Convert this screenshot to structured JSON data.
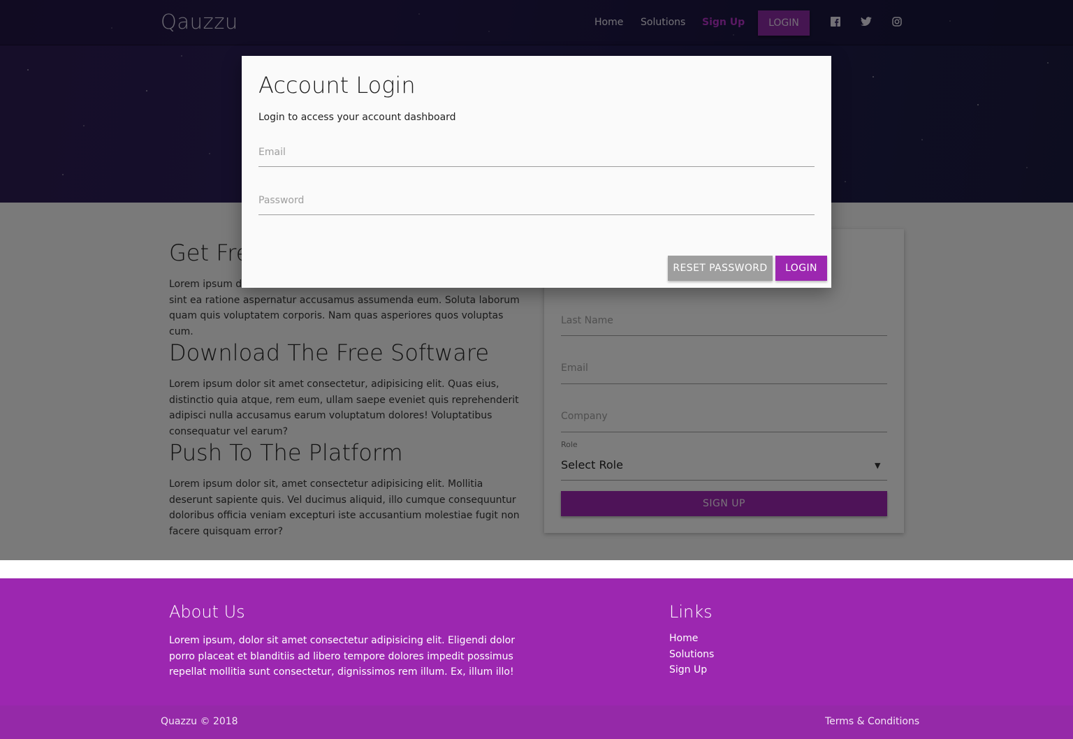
{
  "nav": {
    "brand": "Qauzzu",
    "links": [
      "Home",
      "Solutions",
      "Sign Up"
    ],
    "login": "LOGIN",
    "social_icons": [
      "facebook-icon",
      "twitter-icon",
      "instagram-icon"
    ]
  },
  "sections": [
    {
      "title": "Get Fre",
      "body": "Lorem ipsum dol\nsint ea ratione aspernatur accusamus assumenda eum. Soluta laborum quam quis voluptatem corporis. Nam quas asperiores quos voluptas cum."
    },
    {
      "title": "Download The Free Software",
      "body": "Lorem ipsum dolor sit amet consectetur, adipisicing elit. Quas eius, distinctio quia atque, rem eum, ullam saepe eveniet quis reprehenderit adipisci nulla accusamus earum voluptatum dolores! Voluptatibus consequatur vel earum?"
    },
    {
      "title": "Push To The Platform",
      "body": "Lorem ipsum dolor sit, amet consectetur adipisicing elit. Mollitia deserunt sapiente quis. Vel ducimus aliquid, illo cumque consequuntur doloribus officia veniam excepturi iste accusantium molestiae fugit non facere quisquam error?"
    }
  ],
  "signup": {
    "fields": [
      "Last Name",
      "Email",
      "Company"
    ],
    "role_label": "Role",
    "role_value": "Select Role",
    "button": "SIGN UP"
  },
  "modal": {
    "title": "Account Login",
    "subtitle": "Login to access your account dashboard",
    "email_label": "Email",
    "password_label": "Password",
    "reset_button": "RESET PASSWORD",
    "login_button": "LOGIN"
  },
  "footer": {
    "about_title": "About Us",
    "about_text": "Lorem ipsum, dolor sit amet consectetur adipisicing elit. Eligendi dolor porro placeat et blanditiis ad libero tempore dolores impedit possimus repellat mollitia sunt consectetur, dignissimos rem illum. Ex, illum illo!",
    "links_title": "Links",
    "links": [
      "Home",
      "Solutions",
      "Sign Up"
    ],
    "copyright": "Quazzu © 2018",
    "terms": "Terms & Conditions"
  },
  "colors": {
    "accent": "#9c27b0",
    "accent_dark": "#8a2aa3",
    "hero": "#2a1f58"
  }
}
